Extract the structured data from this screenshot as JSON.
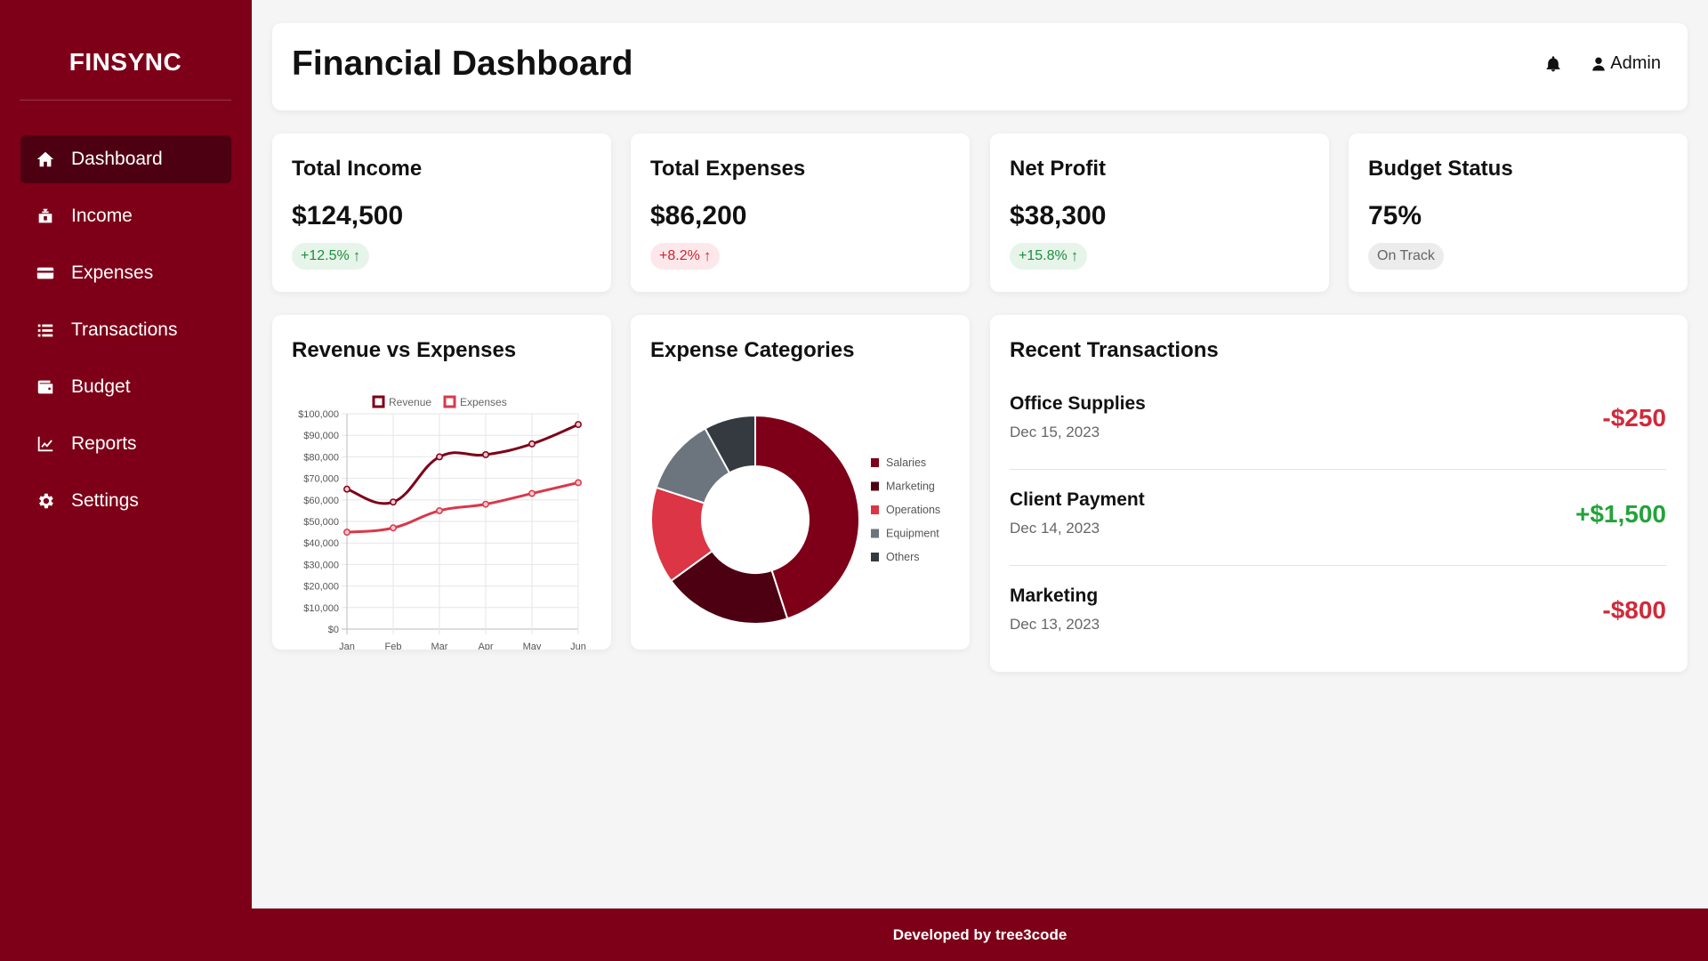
{
  "brand": "FINSYNC",
  "nav": [
    {
      "label": "Dashboard",
      "icon": "home-icon",
      "active": true
    },
    {
      "label": "Income",
      "icon": "money-bag-icon"
    },
    {
      "label": "Expenses",
      "icon": "credit-card-icon"
    },
    {
      "label": "Transactions",
      "icon": "list-icon"
    },
    {
      "label": "Budget",
      "icon": "wallet-icon"
    },
    {
      "label": "Reports",
      "icon": "line-chart-icon"
    },
    {
      "label": "Settings",
      "icon": "gear-icon"
    }
  ],
  "header": {
    "title": "Financial Dashboard",
    "user": "Admin"
  },
  "stats": [
    {
      "title": "Total Income",
      "value": "$124,500",
      "badge": "+12.5%",
      "badge_tone": "green",
      "arrow": "↑"
    },
    {
      "title": "Total Expenses",
      "value": "$86,200",
      "badge": "+8.2%",
      "badge_tone": "red",
      "arrow": "↑"
    },
    {
      "title": "Net Profit",
      "value": "$38,300",
      "badge": "+15.8%",
      "badge_tone": "green",
      "arrow": "↑"
    },
    {
      "title": "Budget Status",
      "value": "75%",
      "badge": "On Track",
      "badge_tone": "gray",
      "arrow": ""
    }
  ],
  "revenue_chart": {
    "title": "Revenue vs Expenses"
  },
  "expense_chart": {
    "title": "Expense Categories"
  },
  "transactions": {
    "title": "Recent Transactions",
    "items": [
      {
        "name": "Office Supplies",
        "date": "Dec 15, 2023",
        "amount": "-$250",
        "tone": "neg"
      },
      {
        "name": "Client Payment",
        "date": "Dec 14, 2023",
        "amount": "+$1,500",
        "tone": "pos"
      },
      {
        "name": "Marketing",
        "date": "Dec 13, 2023",
        "amount": "-$800",
        "tone": "neg"
      }
    ]
  },
  "footer": "Developed by tree3code",
  "colors": {
    "primary": "#7d0018",
    "dark": "#4d0012",
    "revenue": "#7d0018",
    "expenses": "#d9384a"
  },
  "chart_data": [
    {
      "type": "line",
      "title": "Revenue vs Expenses",
      "x": [
        "Jan",
        "Feb",
        "Mar",
        "Apr",
        "May",
        "Jun"
      ],
      "series": [
        {
          "name": "Revenue",
          "values": [
            65000,
            59000,
            80000,
            81000,
            86000,
            95000
          ],
          "color": "#7d0018"
        },
        {
          "name": "Expenses",
          "values": [
            45000,
            47000,
            55000,
            58000,
            63000,
            68000
          ],
          "color": "#d9384a"
        }
      ],
      "ylim": [
        0,
        100000
      ],
      "yticks": [
        "$0",
        "$10,000",
        "$20,000",
        "$30,000",
        "$40,000",
        "$50,000",
        "$60,000",
        "$70,000",
        "$80,000",
        "$90,000",
        "$100,000"
      ],
      "legend": "top",
      "grid": true
    },
    {
      "type": "pie",
      "title": "Expense Categories",
      "categories": [
        "Salaries",
        "Marketing",
        "Operations",
        "Equipment",
        "Others"
      ],
      "values": [
        45,
        20,
        15,
        12,
        8
      ],
      "colors": [
        "#7d0018",
        "#4d0012",
        "#dc3545",
        "#6c757d",
        "#343a40"
      ],
      "legend": "right"
    }
  ]
}
